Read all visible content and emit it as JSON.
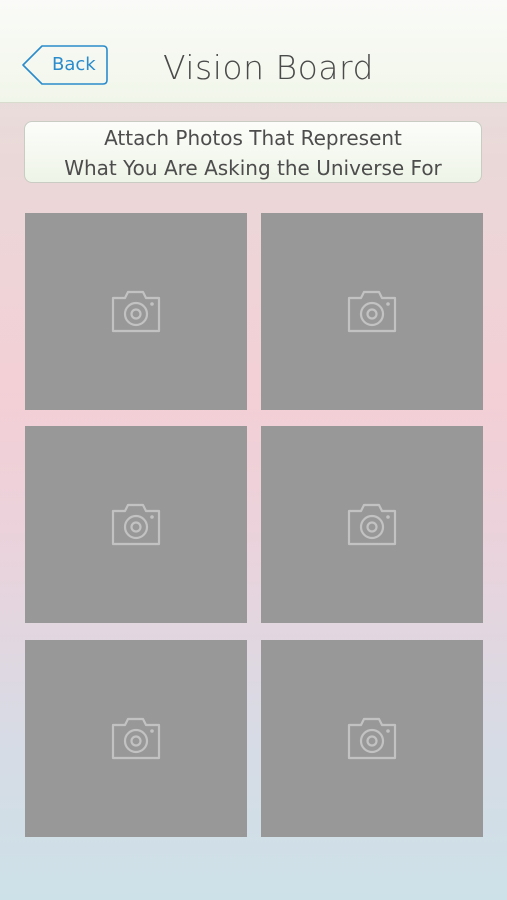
{
  "header": {
    "back_label": "Back",
    "title": "Vision Board"
  },
  "instructions": {
    "line1": "Attach Photos That Represent",
    "line2": "What You Are Asking the Universe For"
  },
  "photo_slots": [
    {
      "icon": "camera-icon"
    },
    {
      "icon": "camera-icon"
    },
    {
      "icon": "camera-icon"
    },
    {
      "icon": "camera-icon"
    },
    {
      "icon": "camera-icon"
    },
    {
      "icon": "camera-icon"
    }
  ],
  "colors": {
    "accent": "#2a8ccc",
    "slot_fill": "#989898",
    "icon_stroke": "#c2c2c2",
    "title_text": "#4a4a4a"
  }
}
